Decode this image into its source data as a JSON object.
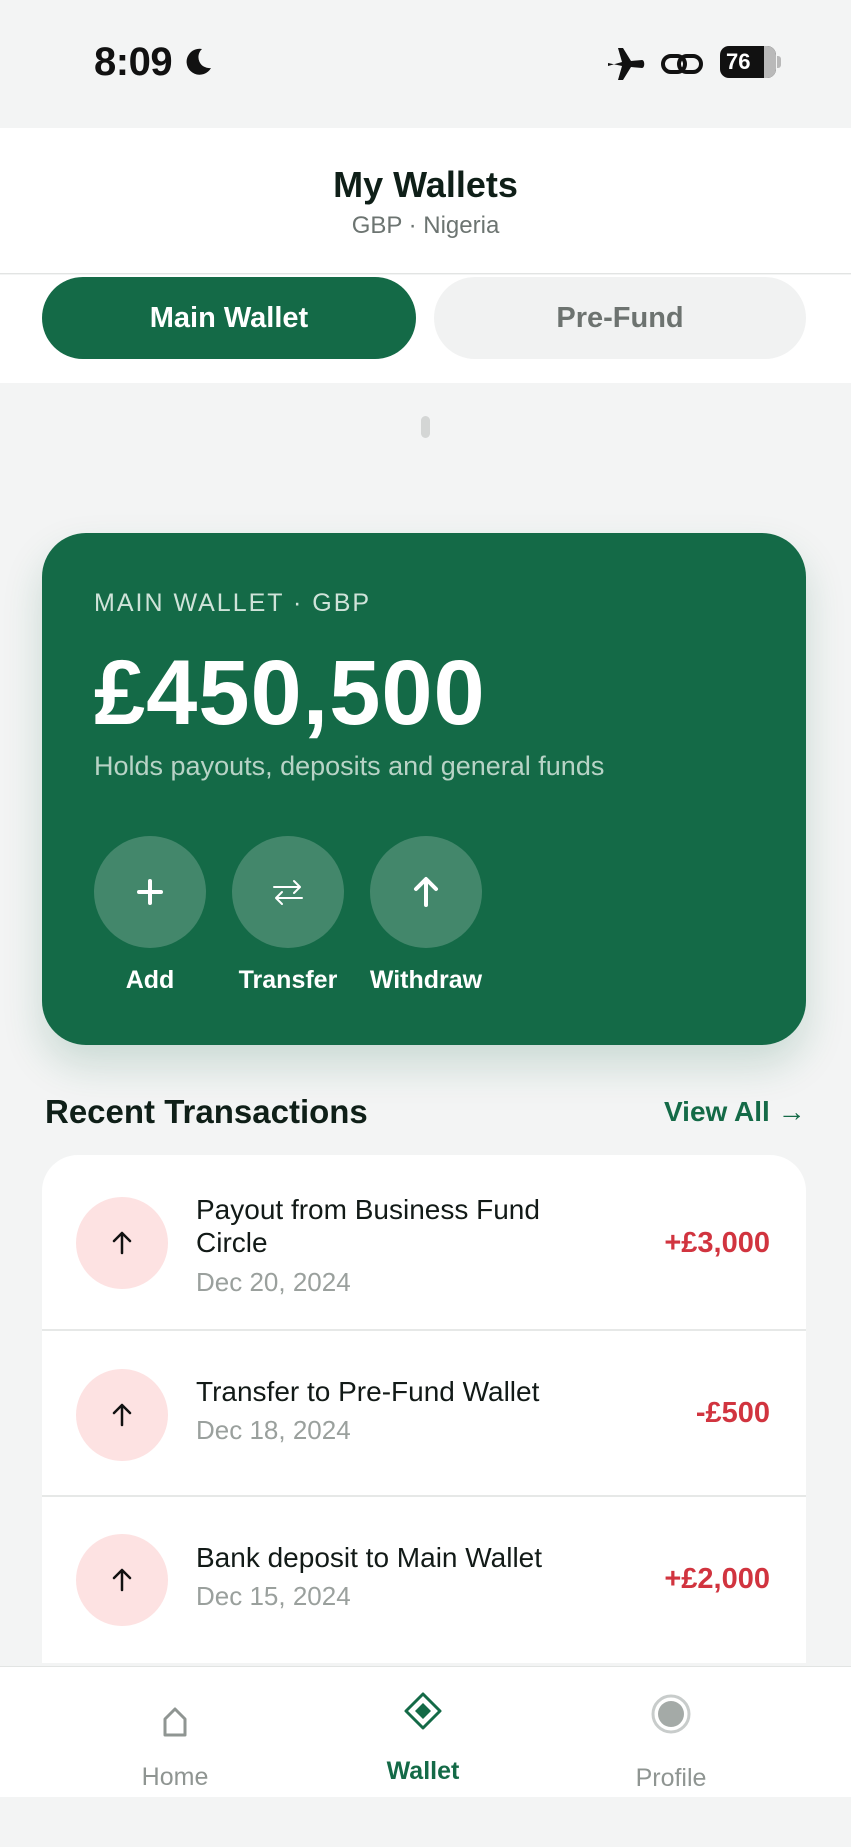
{
  "status_bar": {
    "time": "8:09",
    "battery": "76",
    "icons": [
      "moon-icon",
      "airplane-icon",
      "link-icon",
      "battery-icon"
    ]
  },
  "header": {
    "title": "My Wallets",
    "subtitle": "GBP · Nigeria"
  },
  "tabs": [
    {
      "label": "Main Wallet",
      "active": true
    },
    {
      "label": "Pre-Fund",
      "active": false
    }
  ],
  "wallet_card": {
    "label": "MAIN WALLET · GBP",
    "amount": "£450,500",
    "description": "Holds payouts, deposits and general funds",
    "actions": [
      {
        "label": "Add",
        "icon": "plus-icon"
      },
      {
        "label": "Transfer",
        "icon": "transfer-arrows-icon"
      },
      {
        "label": "Withdraw",
        "icon": "arrow-up-icon"
      }
    ]
  },
  "transactions": {
    "title": "Recent Transactions",
    "view_all": "View All →",
    "items": [
      {
        "title": "Payout from Business Fund Circle",
        "date": "Dec 20, 2024",
        "amount": "+£3,000"
      },
      {
        "title": "Transfer to Pre-Fund Wallet",
        "date": "Dec 18, 2024",
        "amount": "-£500"
      },
      {
        "title": "Bank deposit to Main Wallet",
        "date": "Dec 15, 2024",
        "amount": "+£2,000"
      }
    ]
  },
  "bottom_nav": [
    {
      "label": "Home",
      "icon": "home-icon",
      "active": false
    },
    {
      "label": "Wallet",
      "icon": "wallet-diamond-icon",
      "active": true
    },
    {
      "label": "Profile",
      "icon": "profile-circle-icon",
      "active": false
    }
  ],
  "colors": {
    "brand_green": "#146a47",
    "negative_red": "#d1343f",
    "background": "#f3f4f4"
  }
}
